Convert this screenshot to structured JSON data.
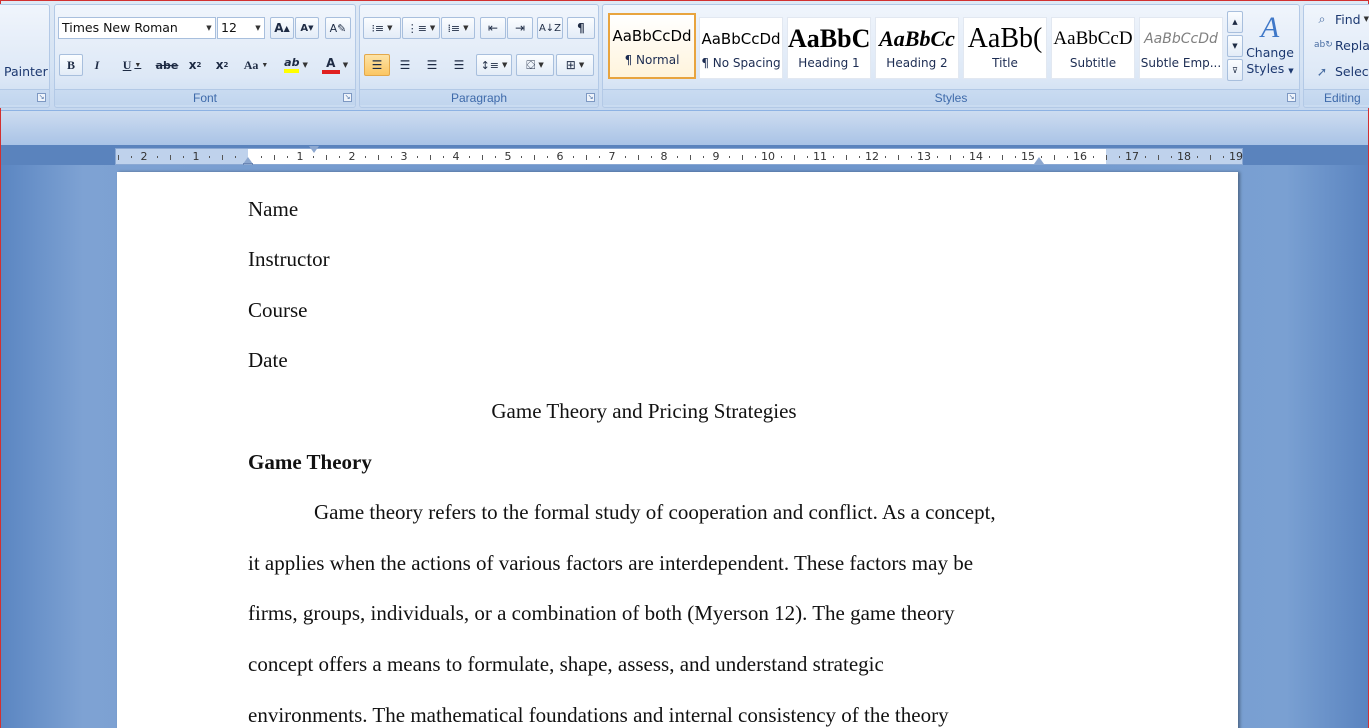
{
  "ribbon": {
    "clipboard": {
      "painter_label": "Painter"
    },
    "font": {
      "group_label": "Font",
      "font_name": "Times New Roman",
      "font_size": "12",
      "grow_label": "A",
      "shrink_label": "A",
      "bold": "B",
      "italic": "I",
      "underline": "U",
      "strikethrough": "abe",
      "subscript": "x",
      "superscript": "x",
      "change_case": "Aa",
      "highlight": "ab",
      "font_color": "A"
    },
    "paragraph": {
      "group_label": "Paragraph",
      "show_marks": "¶"
    },
    "styles": {
      "group_label": "Styles",
      "items": [
        {
          "preview": "AaBbCcDd",
          "name": "¶ Normal"
        },
        {
          "preview": "AaBbCcDd",
          "name": "¶ No Spacing"
        },
        {
          "preview": "AaBbC",
          "name": "Heading 1"
        },
        {
          "preview": "AaBbCc",
          "name": "Heading 2"
        },
        {
          "preview": "AaBb(",
          "name": "Title"
        },
        {
          "preview": "AaBbCcD",
          "name": "Subtitle"
        },
        {
          "preview": "AaBbCcDd",
          "name": "Subtle Emp..."
        }
      ],
      "change_styles_line1": "Change",
      "change_styles_line2": "Styles"
    },
    "editing": {
      "group_label": "Editing",
      "find": "Find",
      "replace": "Replac",
      "select": "Select"
    }
  },
  "ruler": {
    "labels_left": [
      "2",
      "1"
    ],
    "labels_right": [
      "1",
      "2",
      "3",
      "4",
      "5",
      "6",
      "7",
      "8",
      "9",
      "10",
      "11",
      "12",
      "13",
      "14",
      "15",
      "16",
      "17",
      "18",
      "19"
    ]
  },
  "document": {
    "lines": [
      "Name",
      "Instructor",
      "Course",
      "Date"
    ],
    "title": "Game Theory and Pricing Strategies",
    "heading": "Game Theory",
    "body_lines": [
      "Game theory refers to the formal study of cooperation and conflict. As a concept,",
      "it applies when the actions of various factors are interdependent. These factors may be",
      "firms, groups, individuals, or a combination of both (Myerson 12). The game theory",
      "concept offers a means to formulate, shape, assess, and understand strategic",
      "environments. The mathematical foundations and internal consistency of the theory"
    ]
  },
  "colors": {
    "accent": "#15428b",
    "selected_border": "#e8a43f",
    "highlight_yellow": "#ffff00",
    "font_red": "#e02020"
  }
}
